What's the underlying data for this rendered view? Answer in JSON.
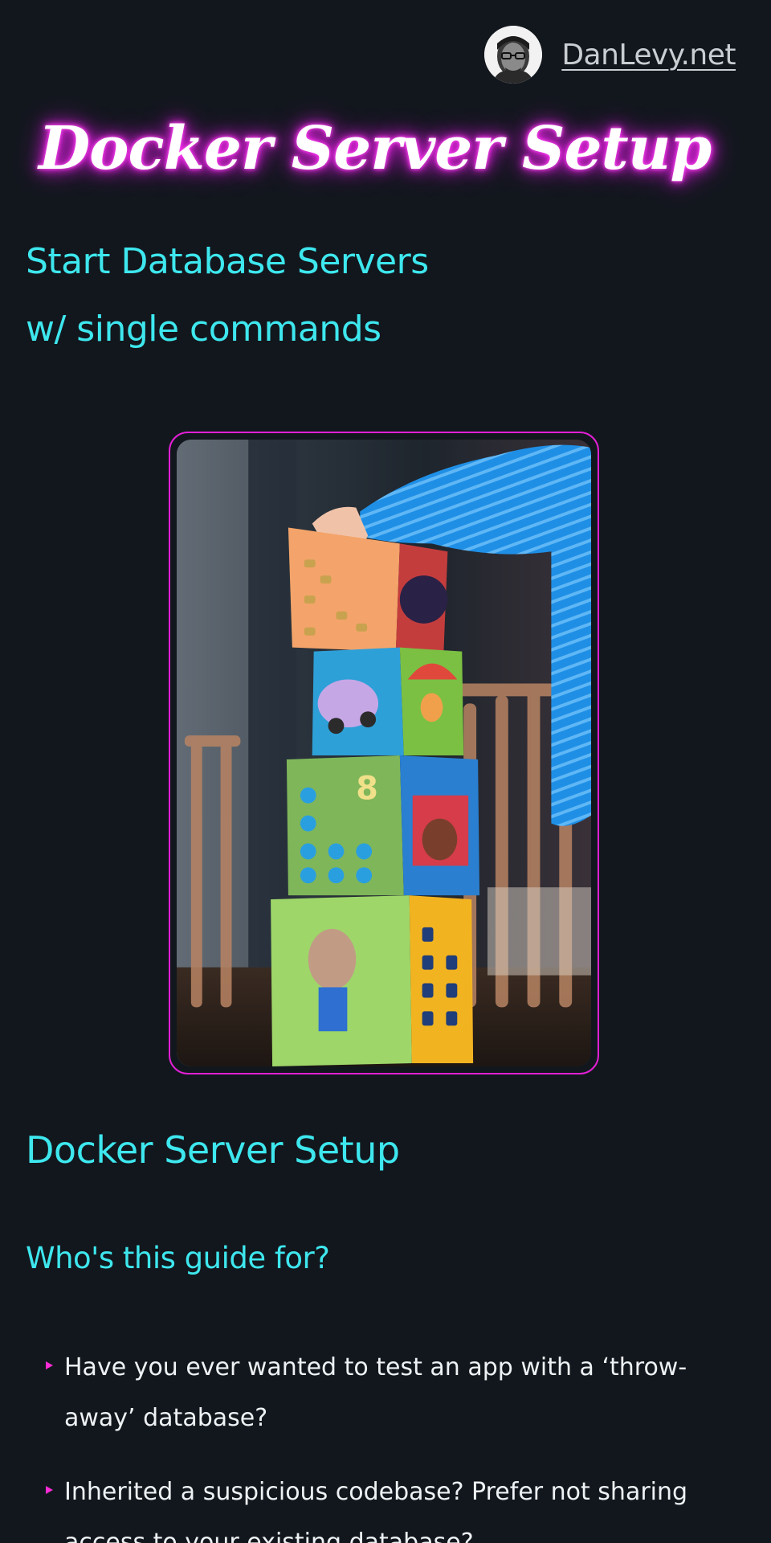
{
  "header": {
    "site_name": "DanLevy.net",
    "avatar_icon": "avatar-photo"
  },
  "hero": {
    "title": "Docker Server Setup",
    "subtitle_line1": "Start Database Servers",
    "subtitle_line2": "w/ single commands",
    "image_icon": "stacked-toy-blocks-photo"
  },
  "article": {
    "heading": "Docker Server Setup",
    "subheading": "Who's this guide for?",
    "bullets": [
      "Have you ever wanted to test an app with a ‘throw-away’ database?",
      "Inherited a suspicious codebase? Prefer not sharing access to your existing database?"
    ]
  },
  "colors": {
    "background": "#12171d",
    "accent_cyan": "#3ee7ee",
    "accent_magenta": "#e21fd6",
    "link_gray": "#c9ced3"
  }
}
